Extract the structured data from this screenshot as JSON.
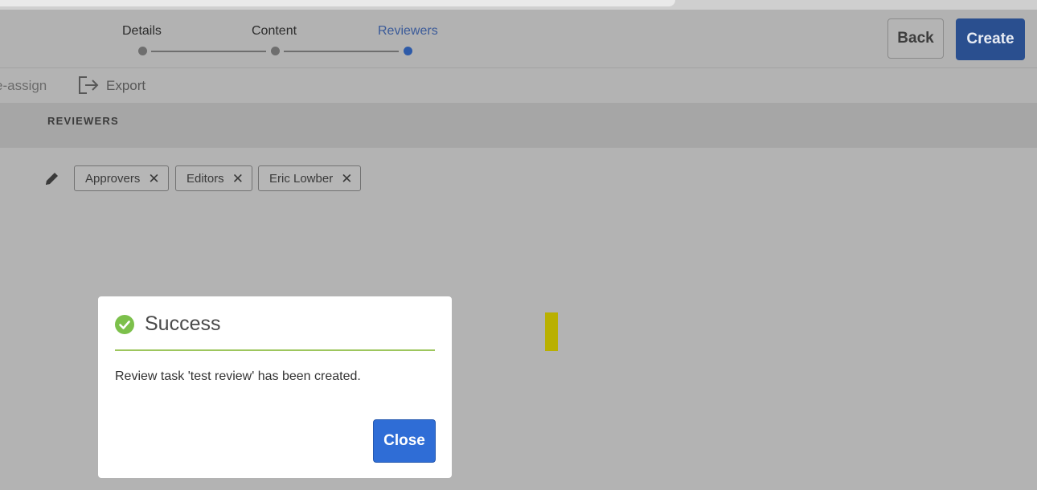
{
  "wizard": {
    "steps": [
      {
        "label": "Details",
        "state": "complete"
      },
      {
        "label": "Content",
        "state": "complete"
      },
      {
        "label": "Reviewers",
        "state": "active"
      }
    ],
    "back_label": "Back",
    "create_label": "Create"
  },
  "actions": {
    "reassign_label": "e-assign",
    "export_label": "Export",
    "export_icon": "export-icon"
  },
  "section": {
    "title": "REVIEWERS"
  },
  "reviewers": {
    "edit_icon": "pencil-icon",
    "chips": [
      "Approvers",
      "Editors",
      "Eric Lowber"
    ],
    "remove_glyph": "✕"
  },
  "dialog": {
    "title": "Success",
    "icon": "check-circle-icon",
    "message": "Review task 'test review' has been created.",
    "close_label": "Close"
  },
  "colors": {
    "accent": "#2a4f8f",
    "success": "#7cc04b",
    "close_button": "#2f6dd6"
  }
}
